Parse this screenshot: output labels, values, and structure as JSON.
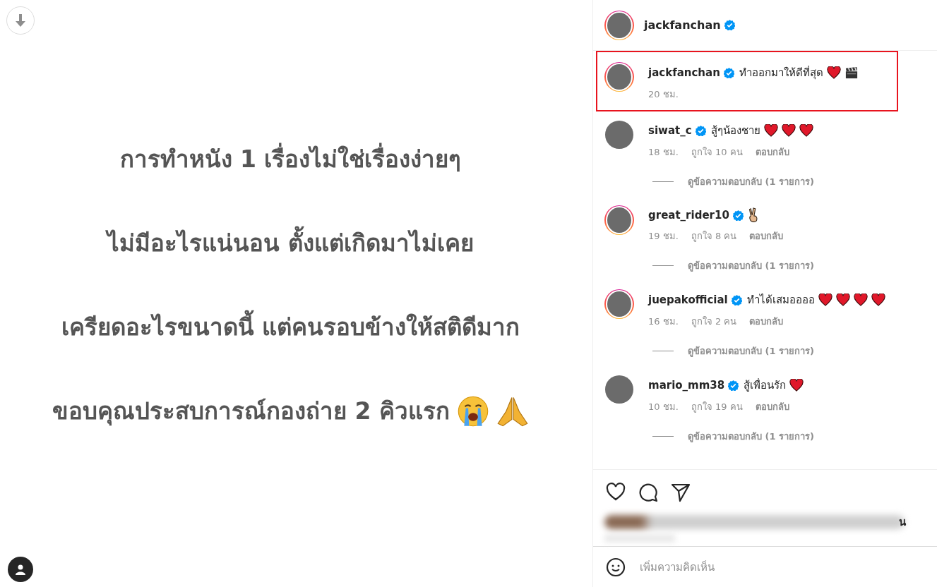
{
  "post_image": {
    "lines": [
      {
        "text": "การทำหนัง 1 เรื่องไม่ใช่เรื่องง่ายๆ"
      },
      {
        "text": "ไม่มีอะไรแน่นอน  ตั้งแต่เกิดมาไม่เคย"
      },
      {
        "text": "เครียดอะไรขนาดนี้ แต่คนรอบข้างให้สติดีมาก"
      },
      {
        "text": "ขอบคุณประสบการณ์กองถ่าย 2 คิวแรก",
        "emojis": [
          {
            "kind": "crying"
          },
          {
            "kind": "pray"
          }
        ]
      }
    ]
  },
  "header": {
    "username": "jackfanchan",
    "verified": true,
    "story_ring": true
  },
  "comments": [
    {
      "username": "jackfanchan",
      "verified": true,
      "story_ring": true,
      "highlighted": true,
      "text": "ทำออกมาให้ดีที่สุด",
      "emojis": [
        {
          "kind": "heart"
        },
        {
          "kind": "clapper"
        }
      ],
      "time": "20 ชม."
    },
    {
      "username": "siwat_c",
      "verified": true,
      "story_ring": false,
      "highlighted": false,
      "text": "สู้ๆน้องชาย",
      "emojis": [
        {
          "kind": "heart"
        },
        {
          "kind": "heart"
        },
        {
          "kind": "heart"
        }
      ],
      "time": "18 ชม.",
      "likes": "ถูกใจ 10 คน",
      "reply": "ตอบกลับ",
      "replies": "ดูข้อความตอบกลับ (1 รายการ)"
    },
    {
      "username": "great_rider10",
      "verified": true,
      "story_ring": true,
      "highlighted": false,
      "emojis": [
        {
          "kind": "victory"
        }
      ],
      "time": "19 ชม.",
      "likes": "ถูกใจ 8 คน",
      "reply": "ตอบกลับ",
      "replies": "ดูข้อความตอบกลับ (1 รายการ)"
    },
    {
      "username": "juepakofficial",
      "verified": true,
      "story_ring": true,
      "highlighted": false,
      "text": "ทำได้เสมออออ",
      "emojis": [
        {
          "kind": "heart"
        },
        {
          "kind": "heart"
        },
        {
          "kind": "heart"
        },
        {
          "kind": "heart"
        }
      ],
      "time": "16 ชม.",
      "likes": "ถูกใจ 2 คน",
      "reply": "ตอบกลับ",
      "replies": "ดูข้อความตอบกลับ (1 รายการ)"
    },
    {
      "username": "mario_mm38",
      "verified": true,
      "story_ring": false,
      "highlighted": false,
      "text": "สู้เพื่อนรัก",
      "emojis": [
        {
          "kind": "heart"
        }
      ],
      "time": "10 ชม.",
      "likes": "ถูกใจ 19 คน",
      "reply": "ตอบกลับ",
      "replies": "ดูข้อความตอบกลับ (1 รายการ)"
    }
  ],
  "likes_fragment": "น",
  "add_comment": {
    "placeholder": "เพิ่มความคิดเห็น"
  }
}
